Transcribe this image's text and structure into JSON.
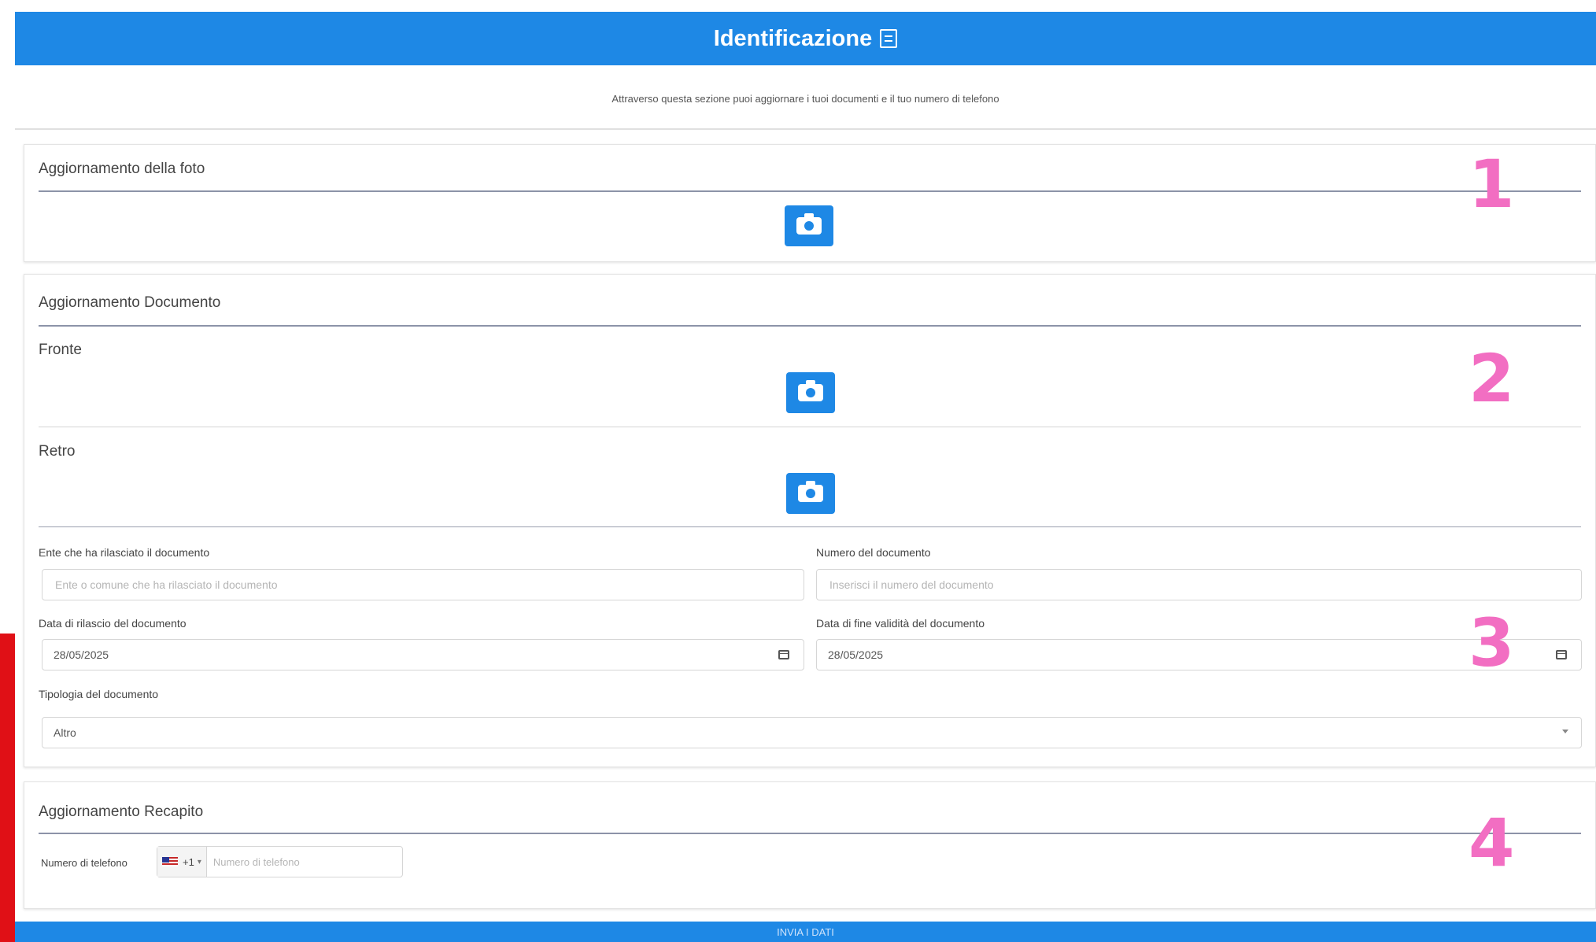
{
  "header": {
    "title": "Identificazione",
    "icon": "document-icon"
  },
  "intro": "Attraverso questa sezione puoi aggiornare i tuoi documenti e il tuo numero di telefono",
  "photo_section": {
    "title": "Aggiornamento della foto",
    "step": "1"
  },
  "document_section": {
    "title": "Aggiornamento Documento",
    "front_label": "Fronte",
    "back_label": "Retro",
    "step": "2",
    "fields_step": "3",
    "issuer": {
      "label": "Ente che ha rilasciato il documento",
      "placeholder": "Ente o comune che ha rilasciato il documento"
    },
    "number": {
      "label": "Numero del documento",
      "placeholder": "Inserisci il numero del documento"
    },
    "issue_date": {
      "label": "Data di rilascio del documento",
      "value": "28/05/2025"
    },
    "expiry_date": {
      "label": "Data di fine validità del documento",
      "value": "28/05/2025"
    },
    "type": {
      "label": "Tipologia del documento",
      "value": "Altro"
    }
  },
  "contact_section": {
    "title": "Aggiornamento Recapito",
    "step": "4",
    "phone_label": "Numero di telefono",
    "country_code": "+1",
    "phone_placeholder": "Numero di telefono"
  },
  "footer": {
    "submit_label": "INVIA I DATI"
  },
  "colors": {
    "primary": "#1e88e5",
    "step_pink": "#f26ec2",
    "red_marker": "#e01016"
  }
}
